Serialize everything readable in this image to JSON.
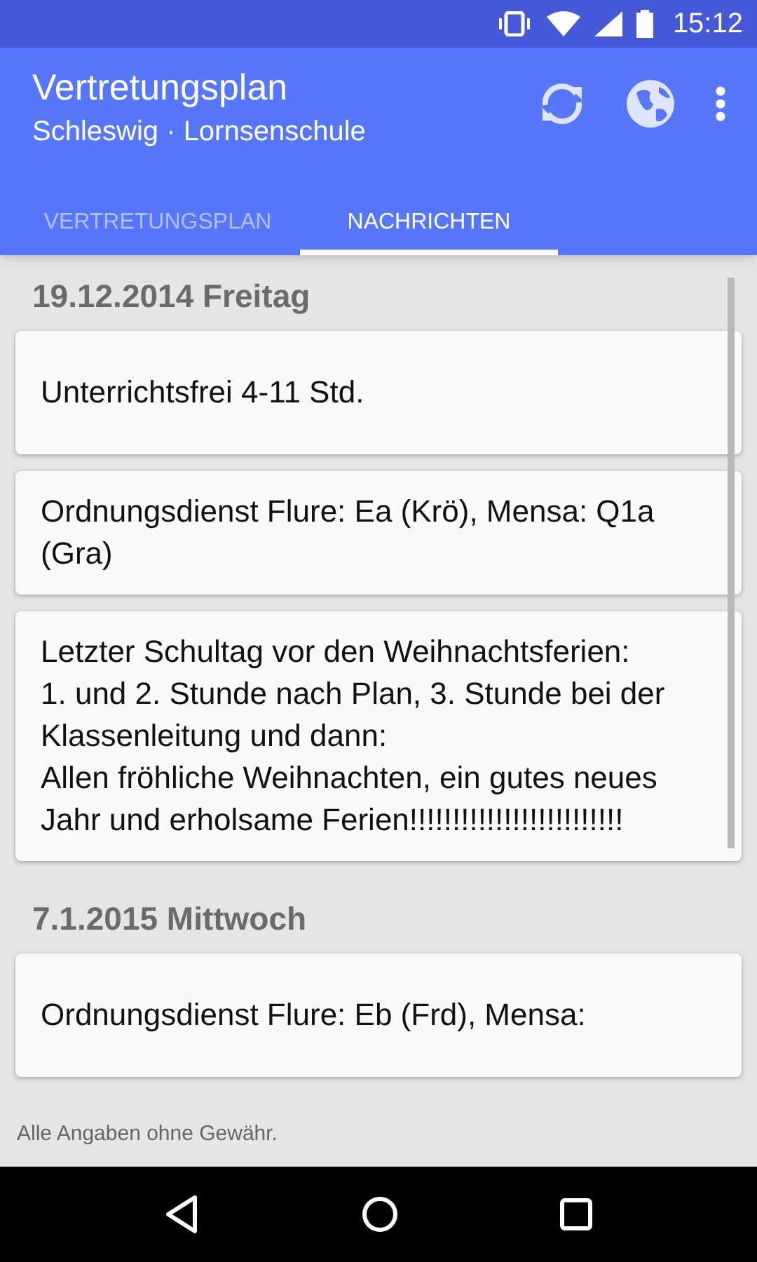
{
  "status_bar": {
    "time": "15:12"
  },
  "app_bar": {
    "title": "Vertretungsplan",
    "subtitle": "Schleswig · Lornsenschule"
  },
  "tabs": [
    {
      "label": "VERTRETUNGSPLAN",
      "selected": false
    },
    {
      "label": "NACHRICHTEN",
      "selected": true
    }
  ],
  "days": [
    {
      "date": "19.12.2014 Freitag",
      "messages": [
        "Unterrichtsfrei 4-11 Std.",
        "Ordnungsdienst Flure: Ea (Krö), Mensa: Q1a (Gra)",
        "Letzter Schultag vor den Weihnachtsferien:\n1. und 2. Stunde nach Plan, 3. Stunde bei der Klassenleitung und dann:\nAllen fröhliche Weihnachten, ein gutes neues Jahr und erholsame Ferien!!!!!!!!!!!!!!!!!!!!!!!!!"
      ]
    },
    {
      "date": "7.1.2015 Mittwoch",
      "messages": [
        "Ordnungsdienst Flure: Eb (Frd), Mensa:"
      ]
    }
  ],
  "footer": "Alle Angaben ohne Gewähr."
}
